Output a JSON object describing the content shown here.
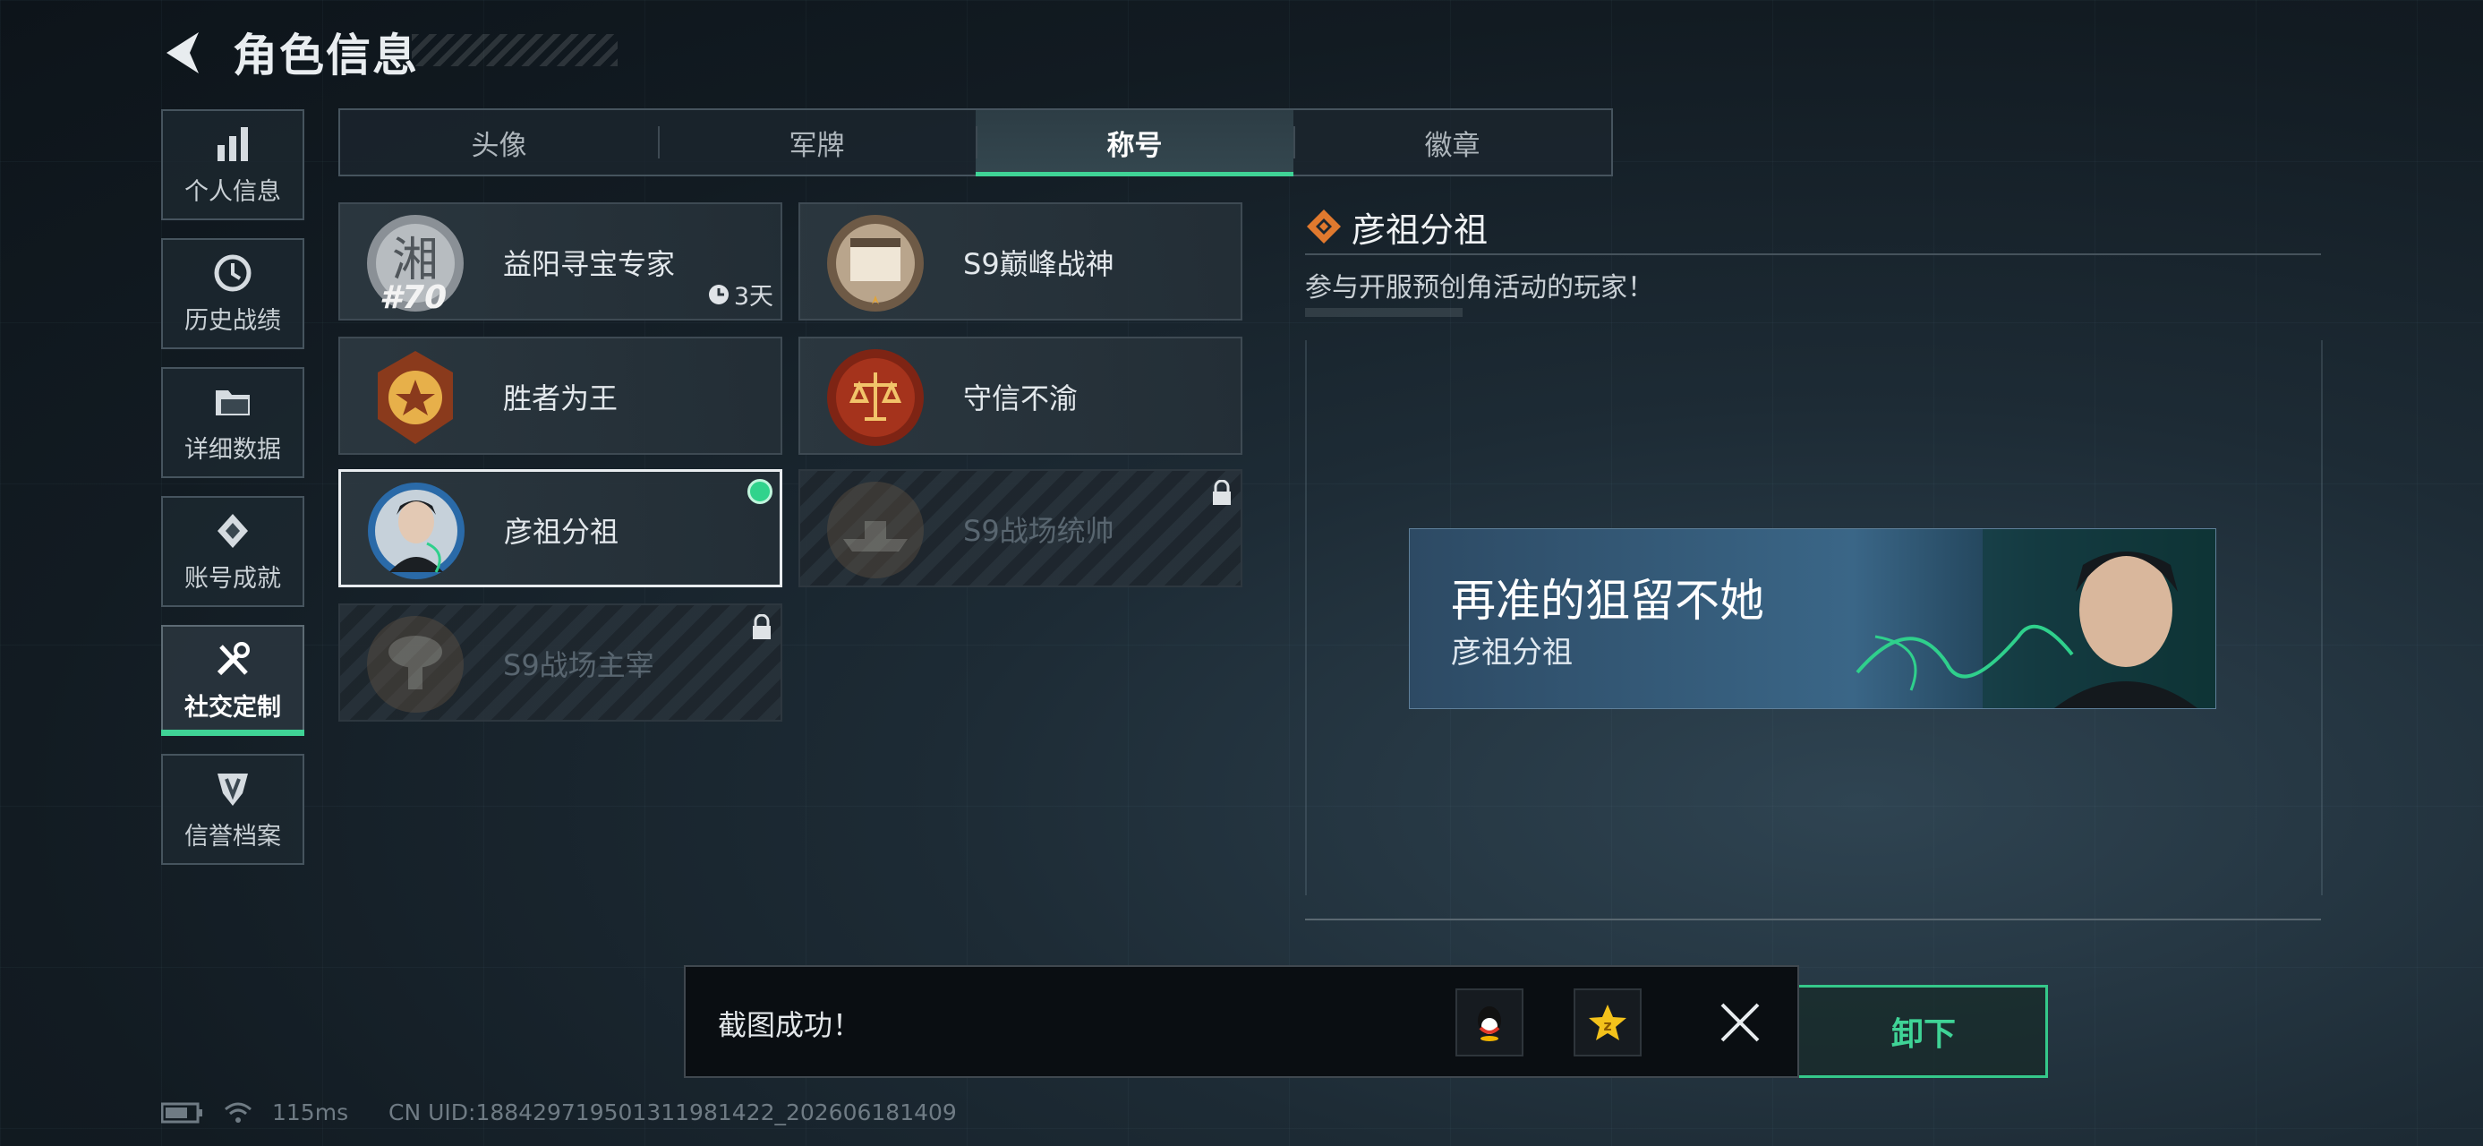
{
  "header": {
    "title": "角色信息"
  },
  "sidebar": {
    "items": [
      {
        "label": "个人信息",
        "icon": "bar-chart-icon"
      },
      {
        "label": "历史战绩",
        "icon": "clock-icon"
      },
      {
        "label": "详细数据",
        "icon": "folder-icon"
      },
      {
        "label": "账号成就",
        "icon": "achievement-icon"
      },
      {
        "label": "社交定制",
        "icon": "tools-icon",
        "active": true
      },
      {
        "label": "信誉档案",
        "icon": "credit-icon"
      }
    ]
  },
  "tabs": [
    {
      "label": "头像"
    },
    {
      "label": "军牌"
    },
    {
      "label": "称号",
      "active": true
    },
    {
      "label": "徽章"
    }
  ],
  "titles": [
    {
      "name": "益阳寻宝专家",
      "badge_number": "#70",
      "badge_char": "湘",
      "timer": "3天",
      "state": "owned"
    },
    {
      "name": "S9巅峰战神",
      "state": "owned"
    },
    {
      "name": "胜者为王",
      "state": "owned"
    },
    {
      "name": "守信不渝",
      "state": "owned"
    },
    {
      "name": "彦祖分祖",
      "state": "selected"
    },
    {
      "name": "S9战场统帅",
      "state": "locked"
    },
    {
      "name": "S9战场主宰",
      "state": "locked"
    }
  ],
  "detail": {
    "title": "彦祖分祖",
    "description": "参与开服预创角活动的玩家！",
    "banner": {
      "title": "再准的狙留不她",
      "subtitle": "彦祖分祖"
    }
  },
  "unequip_button": {
    "label": "卸下"
  },
  "toast": {
    "message": "截图成功！"
  },
  "status_bar": {
    "latency": "115ms",
    "uid": "CN UID:18842971950131198142​2_202606181409"
  },
  "colors": {
    "accent": "#3fd396",
    "background": "#121b22"
  }
}
